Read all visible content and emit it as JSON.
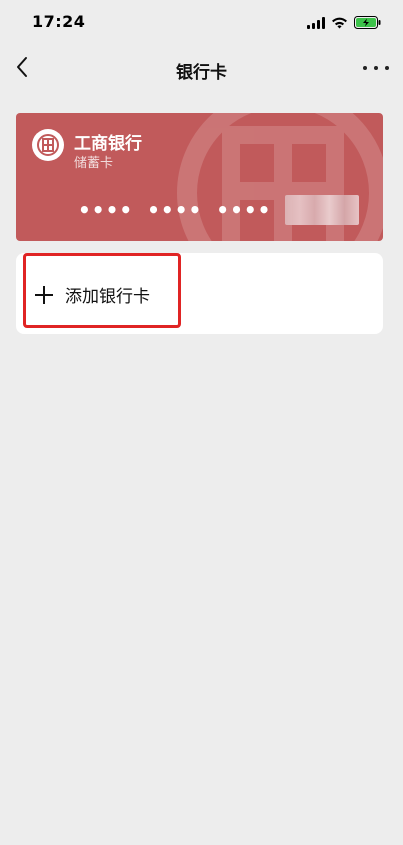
{
  "status_bar": {
    "time": "17:24",
    "icons": [
      "signal-icon",
      "wifi-icon",
      "battery-charging-icon"
    ]
  },
  "nav": {
    "title": "银行卡",
    "back_icon": "chevron-left-icon",
    "more_icon": "more-icon"
  },
  "card": {
    "bank_name": "工商银行",
    "card_type": "储蓄卡",
    "number_groups": [
      "••••",
      "••••",
      "••••"
    ],
    "color": "#c15a5b",
    "logo_icon": "icbc-logo-icon"
  },
  "add_card": {
    "label": "添加银行卡",
    "icon": "plus-icon",
    "highlight_color": "#e02424"
  }
}
